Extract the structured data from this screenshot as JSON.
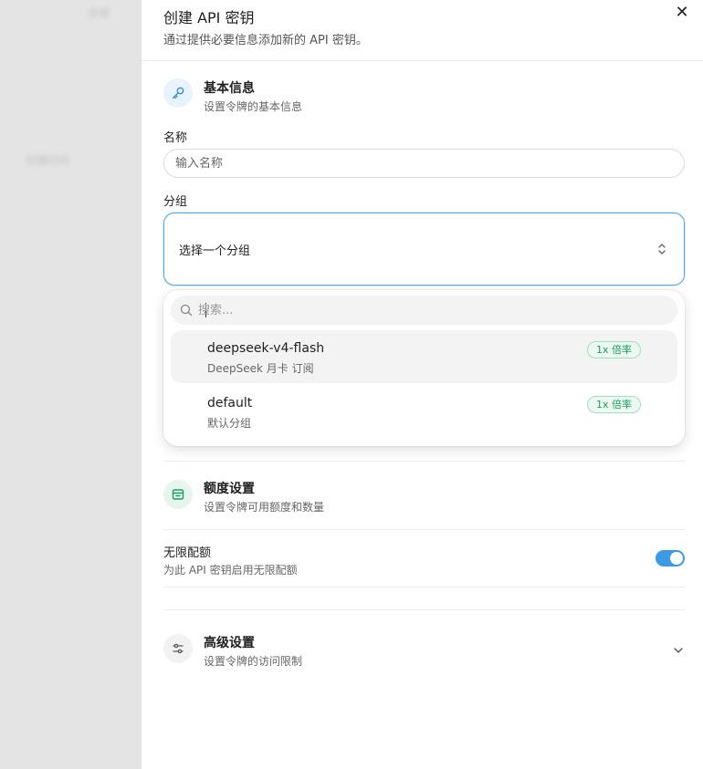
{
  "backdrop": {
    "texts": [
      "全部",
      "创建时间"
    ]
  },
  "drawer": {
    "title": "创建 API 密钥",
    "subtitle": "通过提供必要信息添加新的 API 密钥。"
  },
  "basic_section": {
    "title": "基本信息",
    "subtitle": "设置令牌的基本信息",
    "icon": "key-icon",
    "icon_bg": "#e8f3fc",
    "icon_color": "#3b8fd6"
  },
  "name_field": {
    "label": "名称",
    "placeholder": "输入名称",
    "value": ""
  },
  "group_field": {
    "label": "分组",
    "value": "选择一个分组"
  },
  "group_dropdown": {
    "search_placeholder": "搜索...",
    "options": [
      {
        "name": "deepseek-v4-flash",
        "description": "DeepSeek 月卡 订阅",
        "ratio": "1x 倍率"
      },
      {
        "name": "default",
        "description": "默认分组",
        "ratio": "1x 倍率"
      }
    ]
  },
  "quota_section": {
    "title": "额度设置",
    "subtitle": "设置令牌可用额度和数量",
    "icon": "wallet-icon",
    "icon_bg": "#e6f6ee",
    "icon_color": "#1a9e5c"
  },
  "unlimited_quota": {
    "label": "无限配额",
    "description": "为此 API 密钥启用无限配额",
    "enabled": true
  },
  "advanced_section": {
    "title": "高级设置",
    "subtitle": "设置令牌的访问限制",
    "icon": "sliders-icon",
    "icon_bg": "#f2f2f2",
    "icon_color": "#555555"
  },
  "colors": {
    "accent": "#3b9ae1",
    "badge_green": "#1a9e5c"
  }
}
